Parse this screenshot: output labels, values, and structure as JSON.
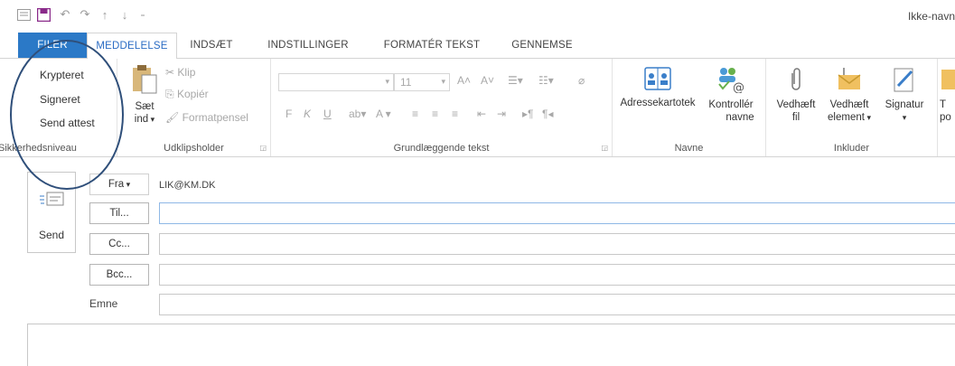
{
  "window": {
    "title": "Ikke-navn"
  },
  "tabs": [
    {
      "label": "FILER"
    },
    {
      "label": "MEDDELELSE"
    },
    {
      "label": "INDSÆT"
    },
    {
      "label": "INDSTILLINGER"
    },
    {
      "label": "FORMATÉR TEKST"
    },
    {
      "label": "GENNEMSE"
    }
  ],
  "ribbon": {
    "security": {
      "items": [
        "Krypteret",
        "Signeret",
        "Send attest"
      ],
      "label": "Sikkerhedsniveau"
    },
    "clipboard": {
      "paste_line1": "Sæt",
      "paste_line2": "ind",
      "cut": "Klip",
      "copy": "Kopiér",
      "format_painter": "Formatpensel",
      "label": "Udklipsholder"
    },
    "basic_text": {
      "font_size": "11",
      "bold": "F",
      "italic": "K",
      "underline": "U",
      "label": "Grundlæggende tekst"
    },
    "names": {
      "address_book": "Adressekartotek",
      "check_names_line1": "Kontrollér",
      "check_names_line2": "navne",
      "label": "Navne"
    },
    "include": {
      "attach_file_line1": "Vedhæft",
      "attach_file_line2": "fil",
      "attach_item_line1": "Vedhæft",
      "attach_item_line2": "element",
      "signature": "Signatur",
      "label": "Inkluder"
    },
    "cutoff": {
      "line1": "T",
      "line2": "po"
    }
  },
  "compose": {
    "send_label": "Send",
    "from_label": "Fra",
    "from_value": "LIK@KM.DK",
    "to_label": "Til...",
    "cc_label": "Cc...",
    "bcc_label": "Bcc...",
    "subject_label": "Emne"
  },
  "colors": {
    "file_tab": "#2b79c7",
    "active_tab_text": "#2b6cc4",
    "annotation_circle": "#2f4f7a"
  }
}
